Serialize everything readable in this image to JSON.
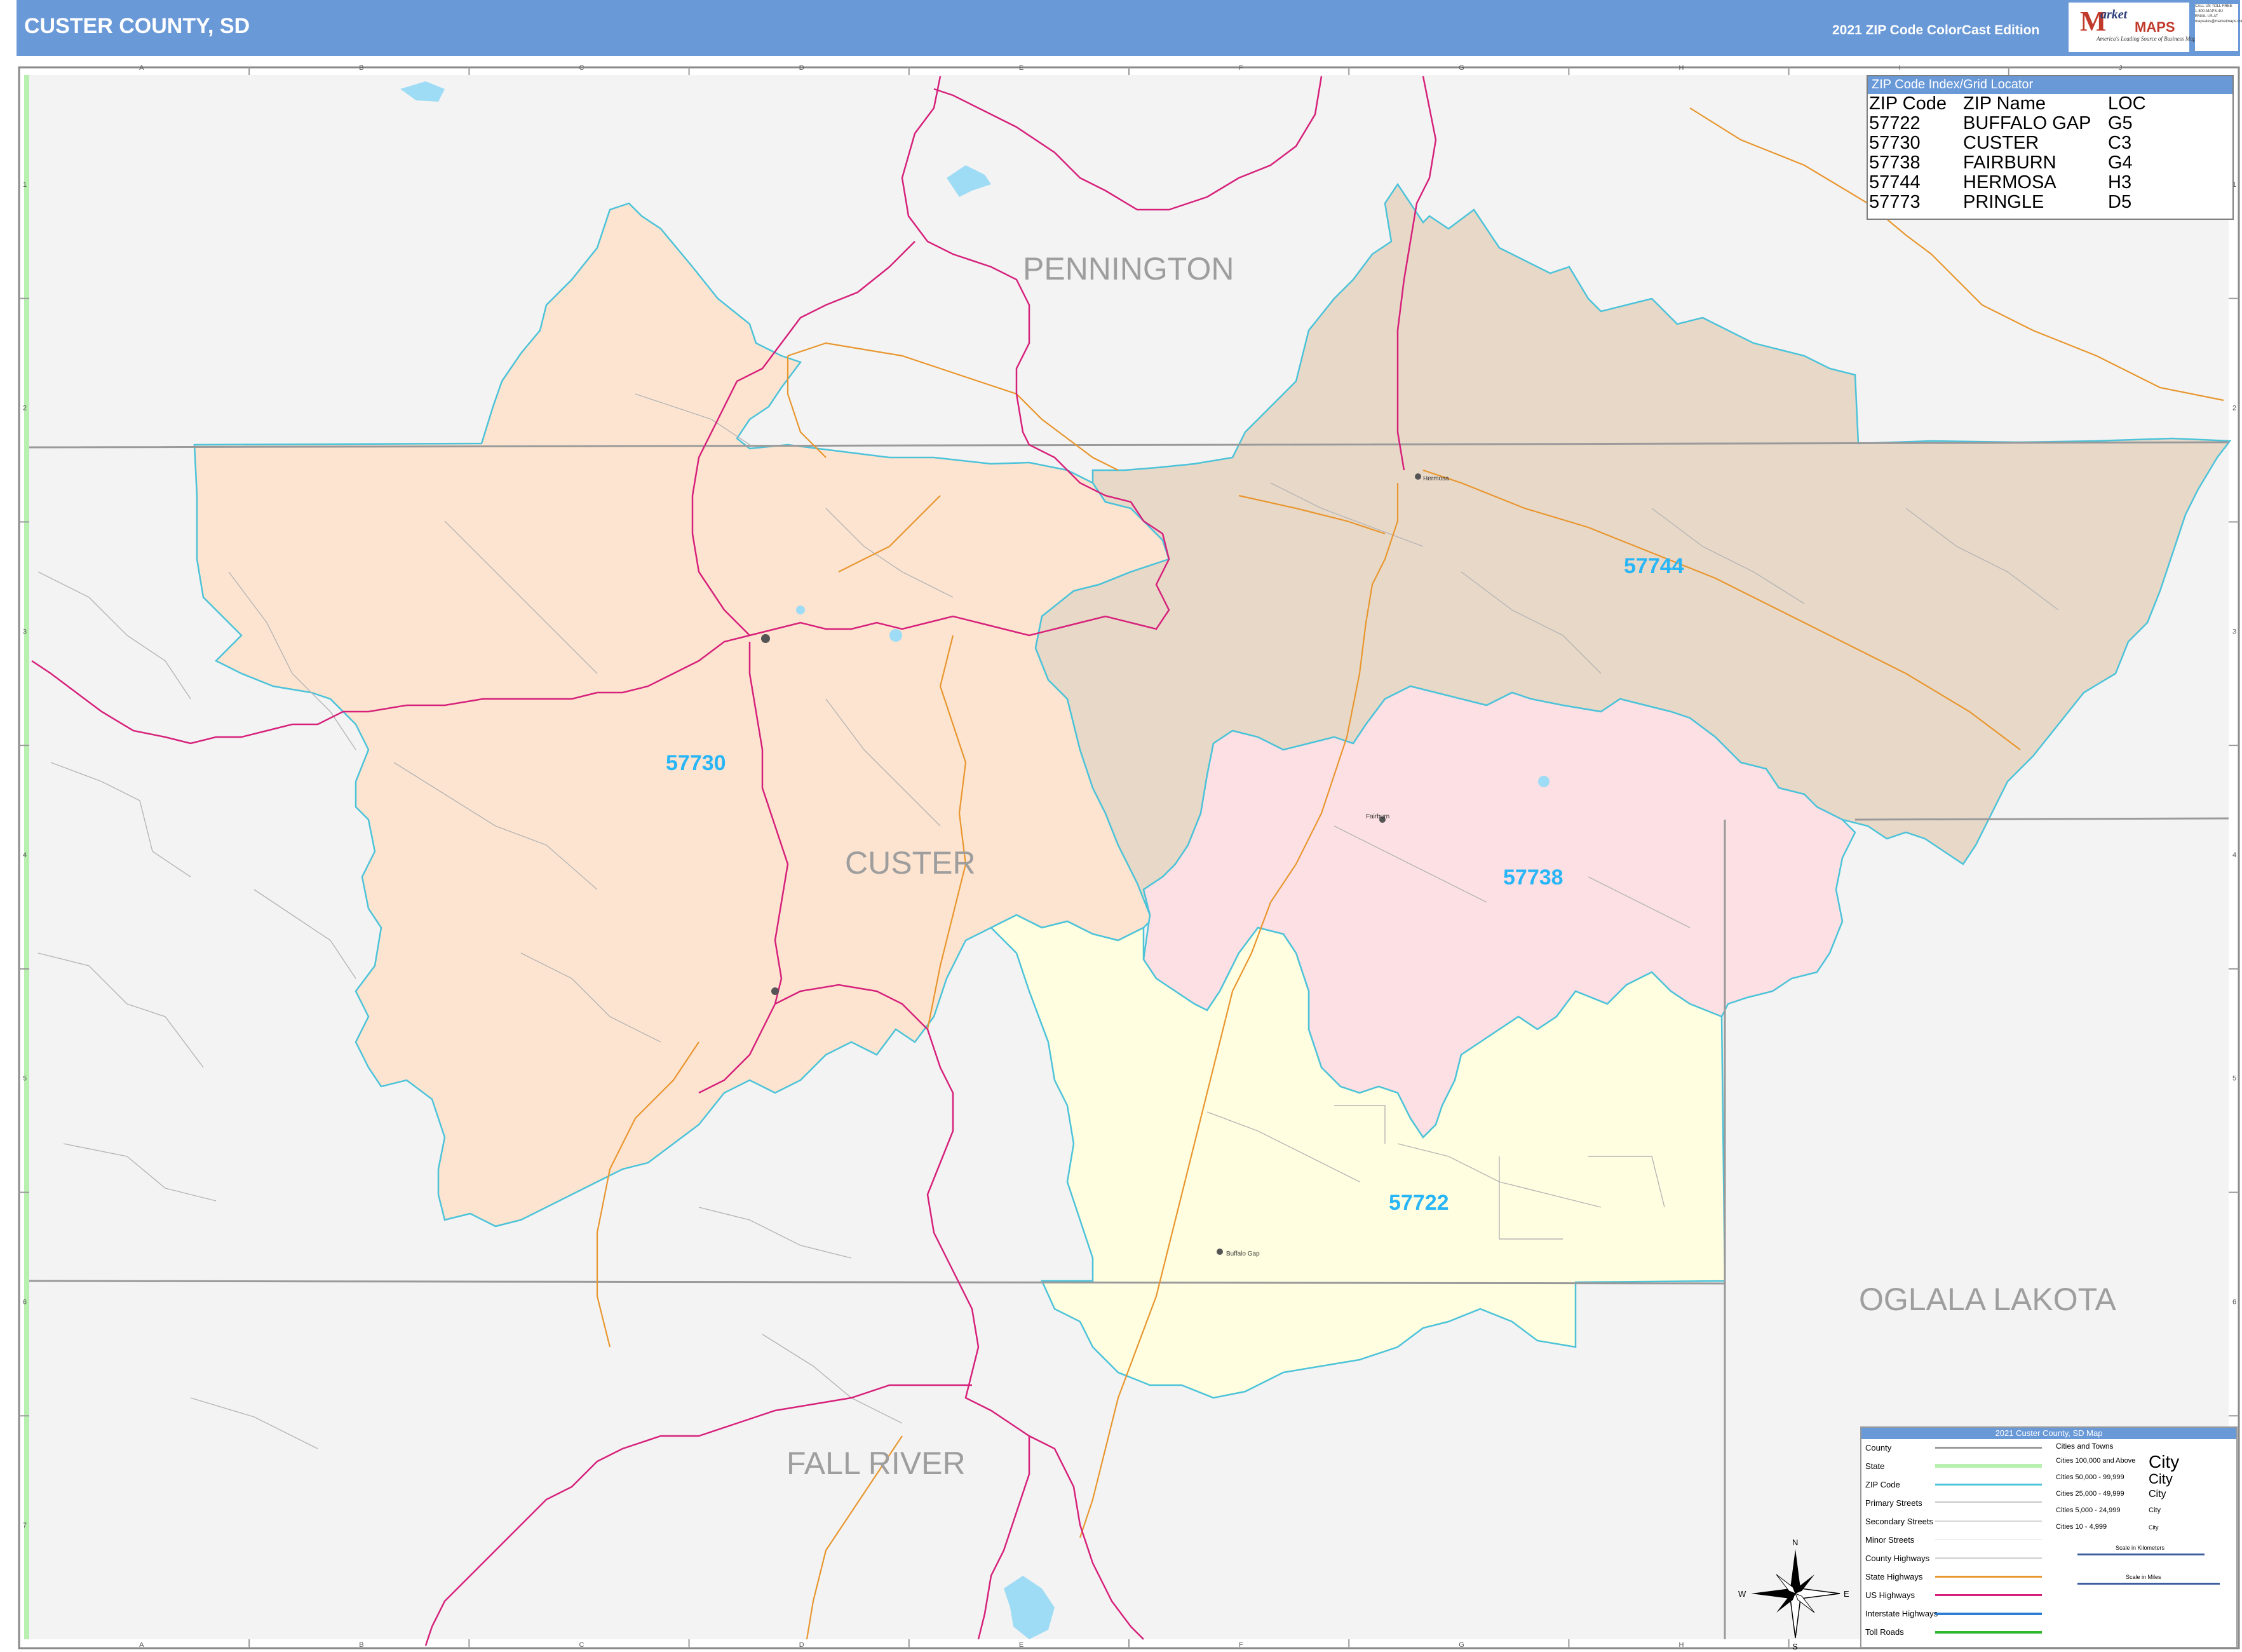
{
  "header": {
    "title": "CUSTER COUNTY, SD",
    "edition": "2021 ZIP Code ColorCast Edition"
  },
  "logo": {
    "m": "M",
    "arket": "arket",
    "maps": "MAPS",
    "tagline": "America's Leading Source of Business Maps",
    "contact": [
      "CALL US TOLL FREE",
      "1-800-MAPS-4U",
      "EMAIL US AT",
      "mapsales@marketmaps.com"
    ]
  },
  "grid": {
    "columns": [
      "A",
      "B",
      "C",
      "D",
      "E",
      "F",
      "G",
      "H",
      "I",
      "J"
    ],
    "rows": [
      "1",
      "2",
      "3",
      "4",
      "5",
      "6",
      "7"
    ]
  },
  "counties": {
    "pennington": "PENNINGTON",
    "custer": "CUSTER",
    "oglala_lakota": "OGLALA LAKOTA",
    "fall_river": "FALL RIVER"
  },
  "zip_areas": [
    {
      "zip": "57730",
      "name": "CUSTER",
      "color": "#fde4d0"
    },
    {
      "zip": "57744",
      "name": "HERMOSA",
      "color": "#e8d8c8"
    },
    {
      "zip": "57738",
      "name": "FAIRBURN",
      "color": "#fde0e4"
    },
    {
      "zip": "57722",
      "name": "BUFFALO GAP",
      "color": "#fffee0"
    }
  ],
  "towns": {
    "hermosa": "Hermosa",
    "fairburn": "Fairburn",
    "buffalo_gap": "Buffalo Gap"
  },
  "colors": {
    "header": "#6a99d8",
    "zip_boundary": "#4cc3d9",
    "zip_label": "#29b6f6",
    "county_label": "#9e9e9e",
    "us_highway": "#d6217b",
    "state_highway": "#e8962e",
    "background": "#f3f3f3",
    "water": "#9edcf5"
  },
  "zip_index": {
    "title": "ZIP Code Index/Grid Locator",
    "headers": [
      "ZIP Code",
      "ZIP Name",
      "LOC"
    ],
    "rows": [
      [
        "57722",
        "BUFFALO GAP",
        "G5"
      ],
      [
        "57730",
        "CUSTER",
        "C3"
      ],
      [
        "57738",
        "FAIRBURN",
        "G4"
      ],
      [
        "57744",
        "HERMOSA",
        "H3"
      ],
      [
        "57773",
        "PRINGLE",
        "D5"
      ]
    ]
  },
  "legend": {
    "title": "2021 Custer County, SD Map",
    "items": [
      "County",
      "State",
      "ZIP Code",
      "Primary Streets",
      "Secondary Streets",
      "Minor Streets",
      "County Highways",
      "State Highways",
      "US Highways",
      "Interstate Highways",
      "Toll Roads"
    ],
    "cities_title": "Cities and Towns",
    "city_classes": [
      {
        "label": "Cities 100,000 and Above",
        "sample": "City"
      },
      {
        "label": "Cities 50,000 - 99,999",
        "sample": "City"
      },
      {
        "label": "Cities 25,000 - 49,999",
        "sample": "City"
      },
      {
        "label": "Cities 5,000 - 24,999",
        "sample": "City"
      },
      {
        "label": "Cities 10 - 4,999",
        "sample": "City"
      }
    ],
    "scale_km": "Scale in Kilometers",
    "scale_mi": "Scale in Miles"
  },
  "compass": {
    "n": "N",
    "s": "S",
    "e": "E",
    "w": "W"
  }
}
